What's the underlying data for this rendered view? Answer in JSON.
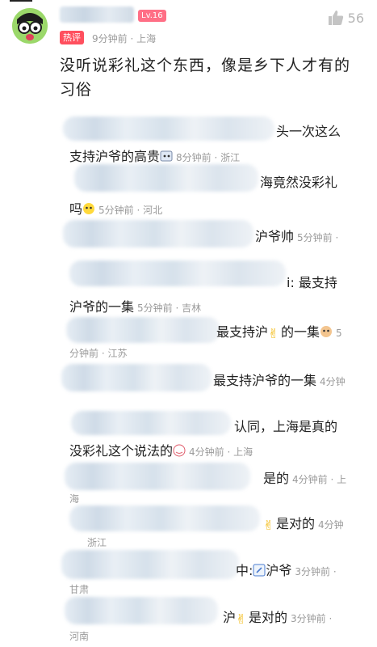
{
  "comment": {
    "level": "Lv.16",
    "likes": "56",
    "hot_tag": "热评",
    "meta": "9分钟前 · 上海",
    "text": "没听说彩礼这个东西，像是乡下人才有的习俗"
  },
  "replies": [
    {
      "line1": "头一次这么",
      "line2": "支持沪爷的高贵",
      "meta": "8分钟前 · 浙江"
    },
    {
      "line1": "海竟然没彩礼",
      "line2": "吗",
      "meta": "5分钟前 · 河北"
    },
    {
      "line1": "沪爷帅",
      "meta": "5分钟前 ·"
    },
    {
      "line1": "i: 最支持",
      "line2": "沪爷的一集",
      "meta": "5分钟前 · 吉林"
    },
    {
      "line1": "最支持沪",
      "line1b": "的一集",
      "meta_tail": "5",
      "line2meta": "分钟前 · 江苏"
    },
    {
      "line1": "最支持沪爷的一集",
      "meta": "4分钟"
    },
    {
      "line1": "认同，上海是真的",
      "line2": "没彩礼这个说法的",
      "meta": "4分钟前 · 上海"
    },
    {
      "line1": "是的",
      "meta": "4分钟前 · 上",
      "line2meta": "海"
    },
    {
      "line1": "是对的",
      "meta": "4分钟",
      "line2meta": "浙江"
    },
    {
      "line1": "中:",
      "line1b": "沪爷",
      "meta": "3分钟前 ·",
      "line2meta": "甘肃"
    },
    {
      "line1": "沪",
      "line1b": "是对的",
      "meta": "3分钟前 ·",
      "line2meta": "河南"
    }
  ],
  "colors": {
    "accent": "#ff4f5e",
    "level_badge": "#ff6f86",
    "avatar_bg": "#9bd86a"
  }
}
